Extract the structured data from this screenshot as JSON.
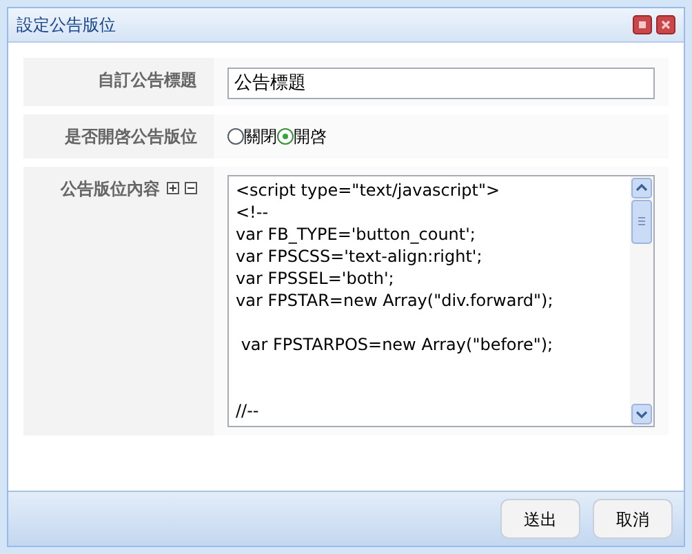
{
  "window": {
    "title": "設定公告版位"
  },
  "fields": [
    {
      "kind": "text",
      "label": "自訂公告標題",
      "value": "公告標題"
    },
    {
      "kind": "radio",
      "label": "是否開啓公告版位",
      "options": [
        {
          "label": "關閉",
          "selected": false
        },
        {
          "label": "開啓",
          "selected": true
        }
      ]
    },
    {
      "kind": "code",
      "label": "公告版位內容",
      "lines": [
        {
          "kind": "code",
          "text": "<script type=\"text/javascript\">"
        },
        {
          "kind": "code",
          "text": "<!--"
        },
        {
          "kind": "code",
          "text": "var FB_TYPE='button_count';"
        },
        {
          "kind": "code",
          "text": "var FPSCSS='text-align:right';"
        },
        {
          "kind": "code",
          "text": "var FPSSEL='both';"
        },
        {
          "kind": "code",
          "text": "var FPSTAR=new Array(\"div.forward\");"
        },
        {
          "kind": "blank"
        },
        {
          "kind": "code",
          "text": " var FPSTARPOS=new Array(\"before\");"
        },
        {
          "kind": "blank"
        },
        {
          "kind": "blank"
        },
        {
          "kind": "code",
          "text": "//--"
        }
      ]
    }
  ],
  "buttons": [
    "送出",
    "取消"
  ]
}
